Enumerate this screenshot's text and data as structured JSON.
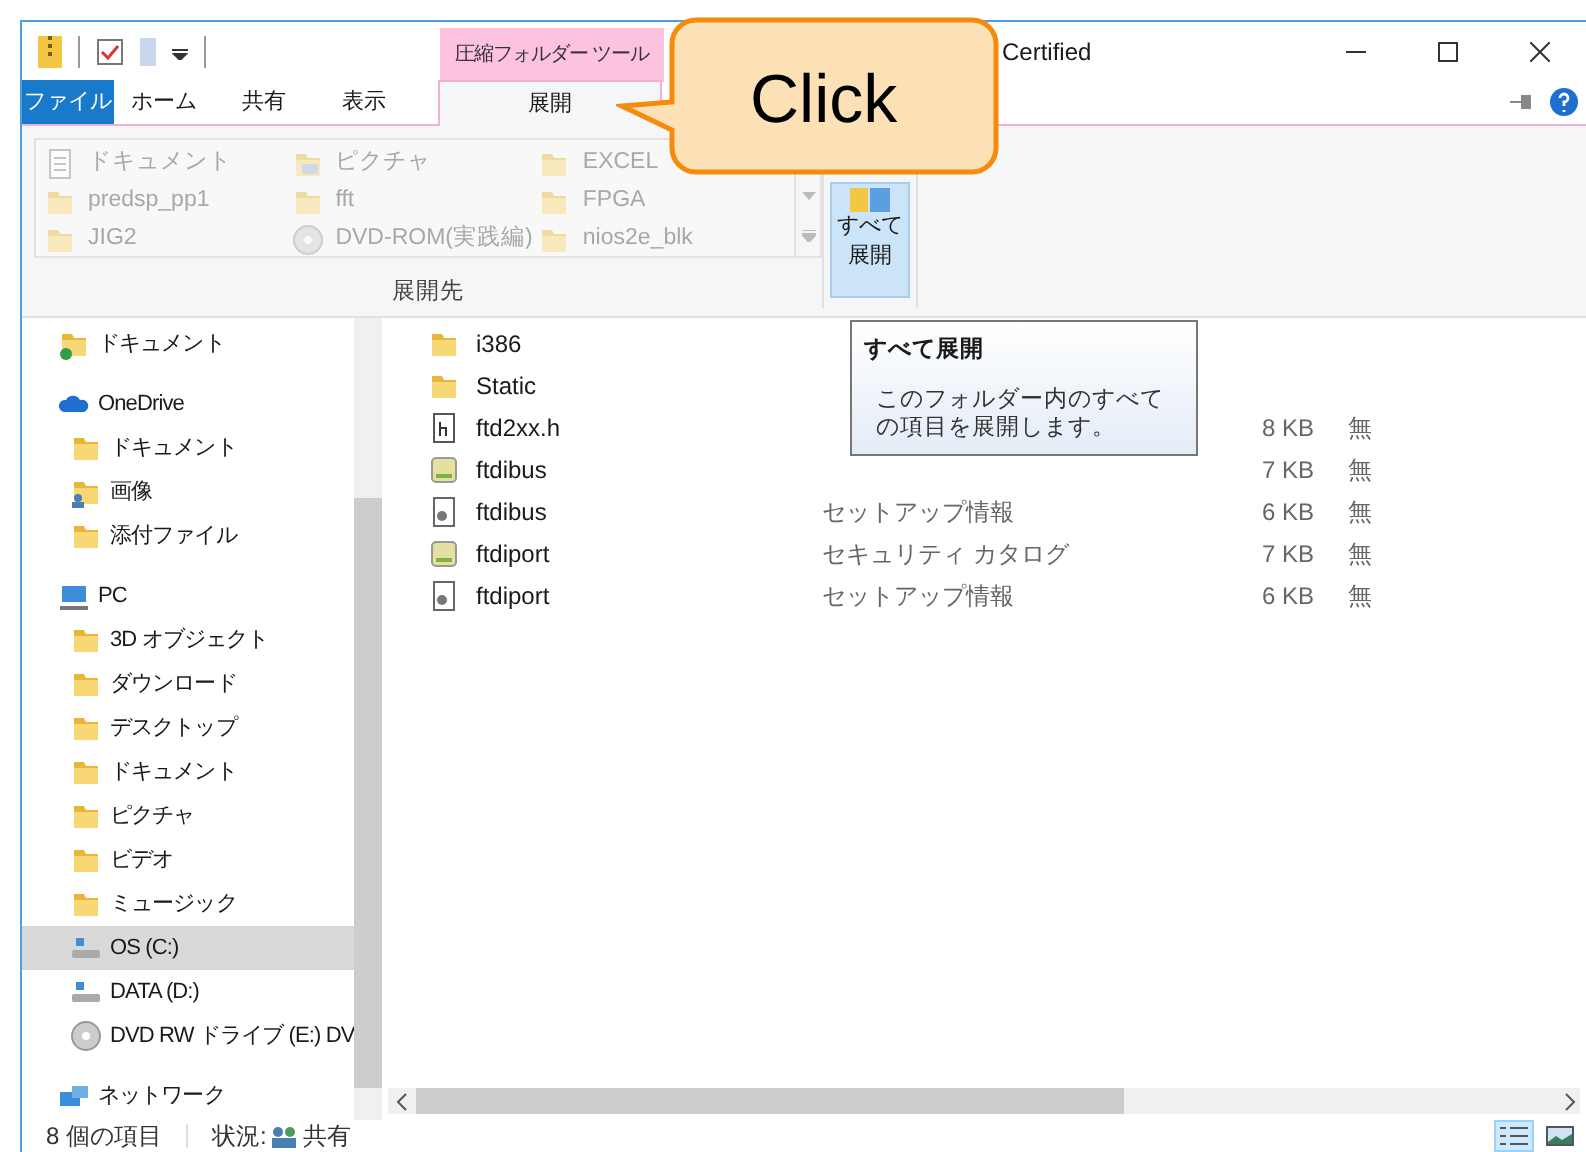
{
  "window": {
    "title": "Certified"
  },
  "context_tab_group": "圧縮フォルダー ツール",
  "tabs": [
    {
      "label": "ファイル",
      "kind": "file",
      "selected": false
    },
    {
      "label": "ホーム",
      "kind": "normal",
      "selected": false
    },
    {
      "label": "共有",
      "kind": "normal",
      "selected": false
    },
    {
      "label": "表示",
      "kind": "normal",
      "selected": false
    },
    {
      "label": "展開",
      "kind": "context",
      "selected": true
    }
  ],
  "ribbon": {
    "gallery": [
      {
        "label": "ドキュメント",
        "kind": "doc",
        "disabled": true
      },
      {
        "label": "ピクチャ",
        "kind": "pic",
        "disabled": true
      },
      {
        "label": "EXCEL",
        "kind": "folder",
        "disabled": true
      },
      {
        "label": "predsp_pp1",
        "kind": "folder",
        "disabled": true
      },
      {
        "label": "fft",
        "kind": "folder",
        "disabled": true
      },
      {
        "label": "FPGA",
        "kind": "folder",
        "disabled": true
      },
      {
        "label": "JIG2",
        "kind": "folder",
        "disabled": true
      },
      {
        "label": "DVD-ROM(実践編)",
        "kind": "dvd",
        "disabled": true
      },
      {
        "label": "nios2e_blk",
        "kind": "folder",
        "disabled": true
      }
    ],
    "group_label": "展開先",
    "extract_all": {
      "label": "すべて展開",
      "hovered": true
    }
  },
  "callout": "Click",
  "tooltip": {
    "title": "すべて展開",
    "text": "このフォルダー内のすべての項目を展開します。"
  },
  "navigation": [
    {
      "label": "ドキュメント",
      "kind": "folder-synced",
      "selected": false
    },
    {
      "label": "OneDrive",
      "kind": "cloud",
      "selected": false,
      "children": [
        {
          "label": "ドキュメント",
          "kind": "folder",
          "selected": false
        },
        {
          "label": "画像",
          "kind": "folder-shared",
          "selected": false
        },
        {
          "label": "添付ファイル",
          "kind": "folder",
          "selected": false
        }
      ]
    },
    {
      "label": "PC",
      "kind": "pc",
      "selected": false,
      "children": [
        {
          "label": "3D オブジェクト",
          "kind": "folder",
          "selected": false
        },
        {
          "label": "ダウンロード",
          "kind": "folder",
          "selected": false
        },
        {
          "label": "デスクトップ",
          "kind": "folder",
          "selected": false
        },
        {
          "label": "ドキュメント",
          "kind": "folder",
          "selected": false
        },
        {
          "label": "ピクチャ",
          "kind": "folder",
          "selected": false
        },
        {
          "label": "ビデオ",
          "kind": "folder",
          "selected": false
        },
        {
          "label": "ミュージック",
          "kind": "folder",
          "selected": false
        },
        {
          "label": "OS (C:)",
          "kind": "drive",
          "selected": true
        },
        {
          "label": "DATA (D:)",
          "kind": "drive",
          "selected": false
        },
        {
          "label": "DVD RW ドライブ (E:) DV",
          "kind": "dvd",
          "selected": false
        }
      ]
    },
    {
      "label": "ネットワーク",
      "kind": "network",
      "selected": false
    }
  ],
  "files": [
    {
      "name": "i386",
      "kind": "folder"
    },
    {
      "name": "Static",
      "kind": "folder"
    },
    {
      "name": "ftd2xx.h",
      "kind": "header",
      "size": "8 KB",
      "attr": "無"
    },
    {
      "name": "ftdibus",
      "kind": "catalog",
      "size": "7 KB",
      "attr": "無"
    },
    {
      "name": "ftdibus",
      "kind": "setup",
      "type": "セットアップ情報",
      "size": "6 KB",
      "attr": "無"
    },
    {
      "name": "ftdiport",
      "kind": "catalog",
      "type": "セキュリティ カタログ",
      "size": "7 KB",
      "attr": "無"
    },
    {
      "name": "ftdiport",
      "kind": "setup",
      "type": "セットアップ情報",
      "size": "6 KB",
      "attr": "無"
    }
  ],
  "status_bar": {
    "count": "8 個の項目",
    "state_label": "状況:",
    "state": "共有"
  },
  "views": [
    {
      "kind": "details",
      "selected": true
    },
    {
      "kind": "tiles",
      "selected": false
    }
  ]
}
